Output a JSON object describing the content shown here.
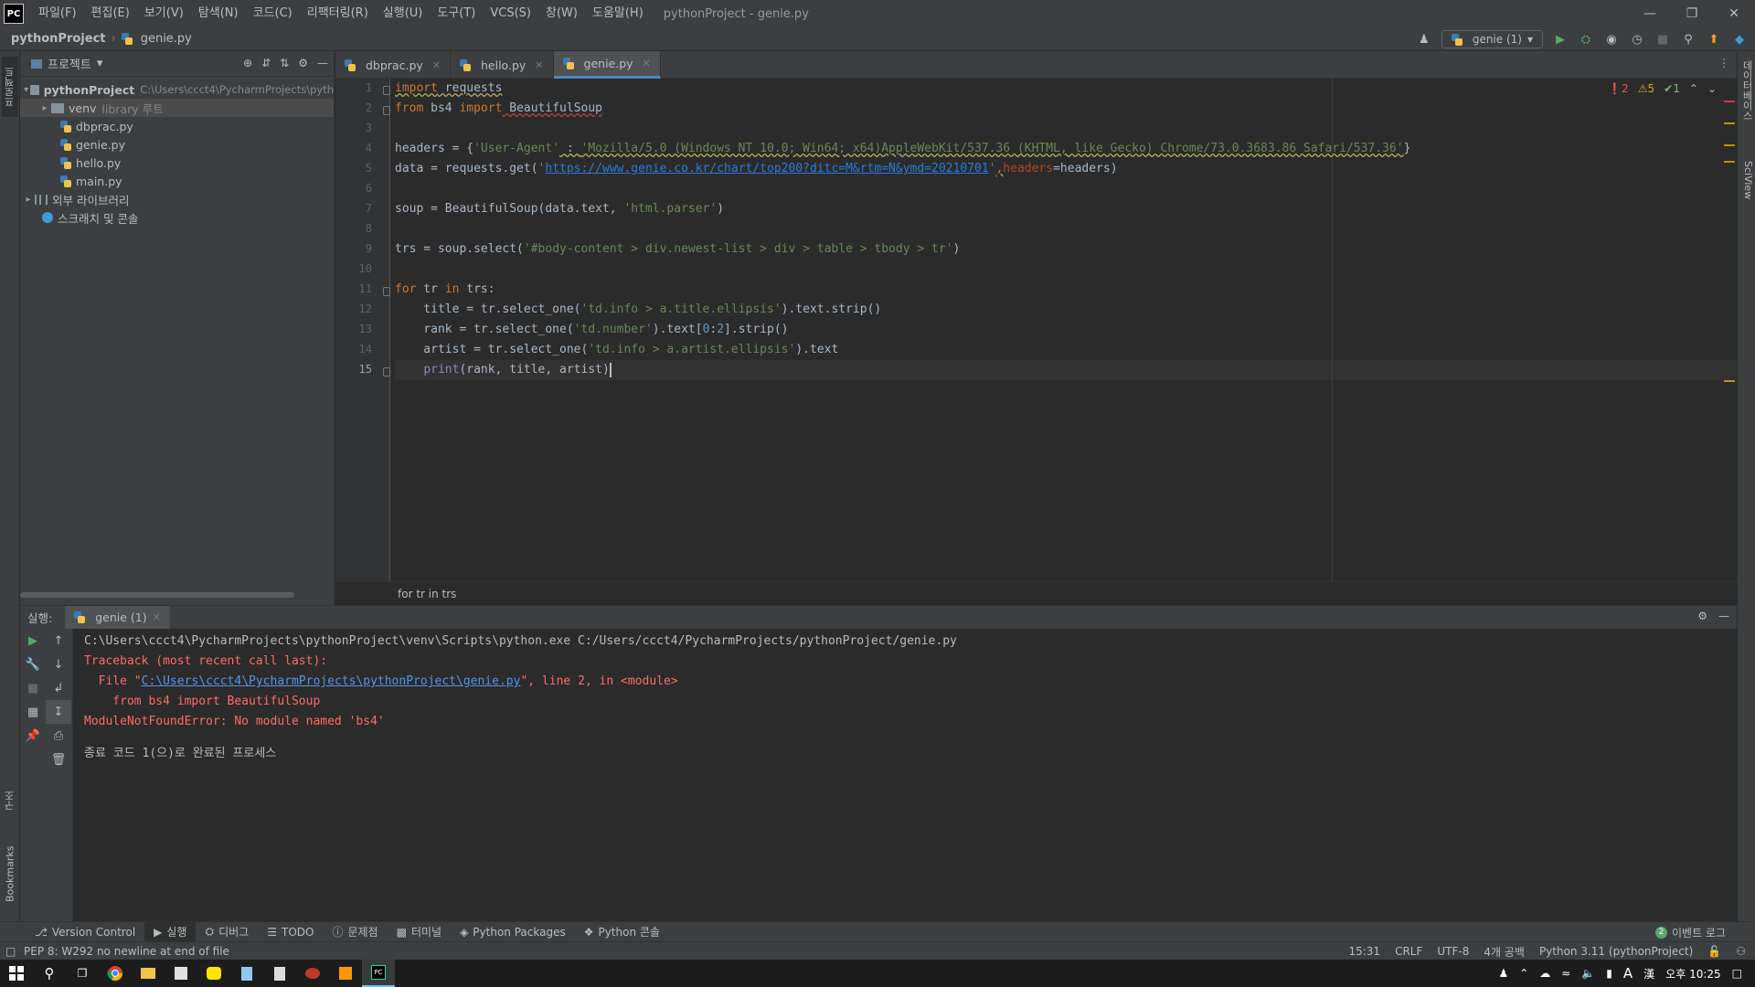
{
  "app": {
    "logo_text": "PC",
    "window_title": "pythonProject - genie.py",
    "menu": [
      "파일(F)",
      "편집(E)",
      "보기(V)",
      "탐색(N)",
      "코드(C)",
      "리팩터링(R)",
      "실행(U)",
      "도구(T)",
      "VCS(S)",
      "창(W)",
      "도움말(H)"
    ]
  },
  "navbar": {
    "root": "pythonProject",
    "file": "genie.py",
    "run_config": "genie (1)"
  },
  "left_strip": {
    "project_tab": "프로젝트",
    "structure_tab": "구조",
    "bookmarks_tab": "Bookmarks"
  },
  "right_strip": {
    "database_tab": "데이터베이스",
    "sciview_tab": "SciView"
  },
  "project_panel": {
    "title": "프로젝트",
    "root_name": "pythonProject",
    "root_path": "C:\\Users\\ccct4\\PycharmProjects\\pyth",
    "venv_name": "venv",
    "venv_sub": "library 루트",
    "files": [
      "dbprac.py",
      "genie.py",
      "hello.py",
      "main.py"
    ],
    "external_libs": "외부 라이브러리",
    "scratches": "스크래치 및 콘솔"
  },
  "editor_tabs": [
    {
      "label": "dbprac.py"
    },
    {
      "label": "hello.py"
    },
    {
      "label": "genie.py"
    }
  ],
  "inspection": {
    "errors": "2",
    "warnings": "5",
    "ok": "1"
  },
  "code": {
    "line_numbers": [
      "1",
      "2",
      "3",
      "4",
      "5",
      "6",
      "7",
      "8",
      "9",
      "10",
      "11",
      "12",
      "13",
      "14",
      "15"
    ],
    "l1_kw": "import",
    "l1_mod": " requests",
    "l2_from": "from",
    "l2_mod": " bs4 ",
    "l2_import": "import",
    "l2_name": " BeautifulSoup",
    "l4_a": "headers = {",
    "l4_key": "'User-Agent'",
    "l4_b": " : ",
    "l4_val": "'Mozilla/5.0 (Windows NT 10.0; Win64; x64)AppleWebKit/537.36 (KHTML, like Gecko) Chrome/73.0.3683.86 Safari/537.36'",
    "l4_c": "}",
    "l5_a": "data = requests.get(",
    "l5_q1": "'",
    "l5_url": "https://www.genie.co.kr/chart/top200?ditc=M&rtm=N&ymd=20210701",
    "l5_q2": "'",
    "l5_b": ",",
    "l5_param": "headers",
    "l5_c": "=headers)",
    "l7_a": "soup = BeautifulSoup(data.text, ",
    "l7_str": "'html.parser'",
    "l7_b": ")",
    "l9_a": "trs = soup.select(",
    "l9_str": "'#body-content > div.newest-list > div > table > tbody > tr'",
    "l9_b": ")",
    "l11_for": "for",
    "l11_a": " tr ",
    "l11_in": "in",
    "l11_b": " trs:",
    "l12_a": "    title = tr.select_one(",
    "l12_str": "'td.info > a.title.ellipsis'",
    "l12_b": ").text.strip()",
    "l13_a": "    rank = tr.select_one(",
    "l13_str": "'td.number'",
    "l13_b": ").text[",
    "l13_n1": "0",
    "l13_c": ":",
    "l13_n2": "2",
    "l13_d": "].strip()",
    "l14_a": "    artist = tr.select_one(",
    "l14_str": "'td.info > a.artist.ellipsis'",
    "l14_b": ").text",
    "l15_indent": "    ",
    "l15_builtin": "print",
    "l15_a": "(rank, title, artist)"
  },
  "editor_breadcrumb": "for tr in trs",
  "run_panel": {
    "label": "실행:",
    "tab": "genie (1)",
    "console": [
      "C:\\Users\\ccct4\\PycharmProjects\\pythonProject\\venv\\Scripts\\python.exe C:/Users/ccct4/PycharmProjects/pythonProject/genie.py",
      "Traceback (most recent call last):",
      "  File \"",
      "C:\\Users\\ccct4\\PycharmProjects\\pythonProject\\genie.py",
      "\", line 2, in <module>",
      "    from bs4 import BeautifulSoup",
      "ModuleNotFoundError: No module named 'bs4'",
      "종료 코드 1(으)로 완료된 프로세스"
    ]
  },
  "tool_tabs": [
    "Version Control",
    "실행",
    "디버그",
    "TODO",
    "문제점",
    "터미널",
    "Python Packages",
    "Python 콘솔"
  ],
  "event_log": {
    "count": "2",
    "label": "이벤트 로그"
  },
  "statusbar": {
    "message": "PEP 8: W292 no newline at end of file",
    "position": "15:31",
    "line_sep": "CRLF",
    "encoding": "UTF-8",
    "indent": "4개 공백",
    "interpreter": "Python 3.11 (pythonProject)"
  },
  "taskbar": {
    "ime": "A",
    "ime2": "漢",
    "clock": "오후 10:25"
  }
}
